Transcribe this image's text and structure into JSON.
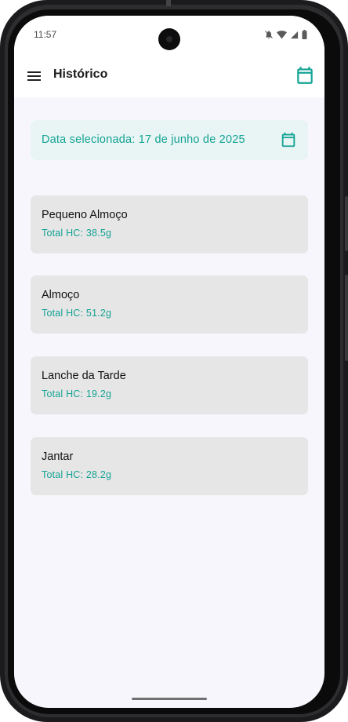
{
  "status_bar": {
    "time": "11:57",
    "icons": [
      "mute-icon",
      "wifi-icon",
      "signal-icon",
      "battery-icon"
    ]
  },
  "app_bar": {
    "title": "Histórico",
    "menu_icon": "menu-icon",
    "action_icon": "calendar-icon"
  },
  "date_selector": {
    "label": "Data selecionada: 17 de junho de 2025",
    "icon": "calendar-icon"
  },
  "meals": [
    {
      "name": "Pequeno Almoço",
      "total": "Total HC: 38.5g"
    },
    {
      "name": "Almoço",
      "total": "Total HC: 51.2g"
    },
    {
      "name": "Lanche da Tarde",
      "total": "Total HC: 19.2g"
    },
    {
      "name": "Jantar",
      "total": "Total HC: 28.2g"
    }
  ],
  "colors": {
    "accent": "#14a394",
    "accent_bg": "#e8f5f4",
    "card_bg": "#e6e6e6",
    "screen_bg": "#f7f6fc"
  }
}
